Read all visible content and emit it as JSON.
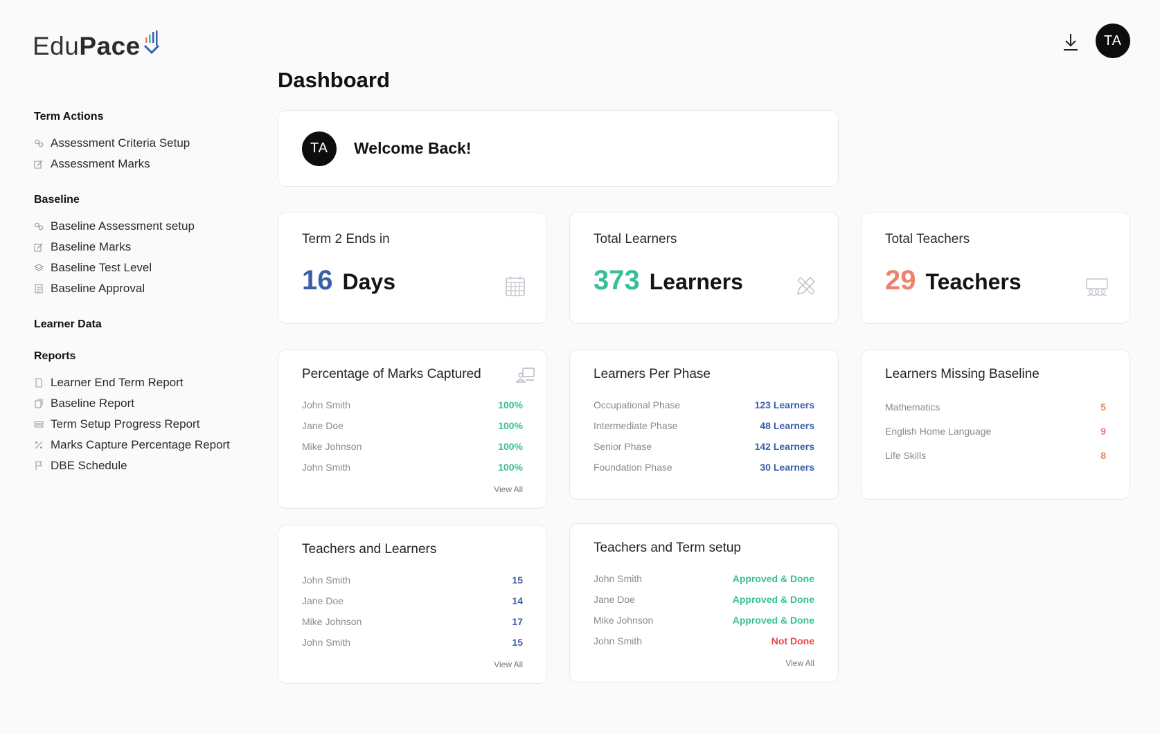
{
  "brand": {
    "name_part1": "Edu",
    "name_part2": "Pace"
  },
  "page_title": "Dashboard",
  "user": {
    "initials": "TA"
  },
  "sidebar": {
    "sections": [
      {
        "title": "Term Actions",
        "items": [
          {
            "label": "Assessment Criteria Setup",
            "icon": "gears-icon"
          },
          {
            "label": "Assessment Marks",
            "icon": "edit-icon"
          }
        ]
      },
      {
        "title": "Baseline",
        "items": [
          {
            "label": "Baseline Assessment setup",
            "icon": "gears-icon"
          },
          {
            "label": "Baseline Marks",
            "icon": "edit-icon"
          },
          {
            "label": "Baseline Test Level",
            "icon": "layers-icon"
          },
          {
            "label": "Baseline Approval",
            "icon": "document-icon"
          }
        ]
      },
      {
        "title": "Learner Data",
        "items": []
      },
      {
        "title": "Reports",
        "items": [
          {
            "label": "Learner End Term Report",
            "icon": "file-icon"
          },
          {
            "label": "Baseline Report",
            "icon": "copy-icon"
          },
          {
            "label": "Term Setup Progress Report",
            "icon": "list-icon"
          },
          {
            "label": "Marks Capture Percentage Report",
            "icon": "percent-icon"
          },
          {
            "label": "DBE Schedule",
            "icon": "flag-icon"
          }
        ]
      }
    ]
  },
  "welcome": {
    "message": "Welcome Back!"
  },
  "stats": {
    "term": {
      "label": "Term 2 Ends in",
      "value": "16",
      "unit": "Days",
      "icon": "calendar-icon",
      "color": "#3a5fa8"
    },
    "learners": {
      "label": "Total Learners",
      "value": "373",
      "unit": "Learners",
      "icon": "pencil-ruler-icon",
      "color": "#37bf98"
    },
    "teachers": {
      "label": "Total Teachers",
      "value": "29",
      "unit": "Teachers",
      "icon": "classroom-icon",
      "color": "#f0806b"
    }
  },
  "marks_captured": {
    "title": "Percentage of Marks Captured",
    "icon": "teacher-board-icon",
    "rows": [
      {
        "name": "John Smith",
        "value": "100%"
      },
      {
        "name": "Jane Doe",
        "value": "100%"
      },
      {
        "name": "Mike Johnson",
        "value": "100%"
      },
      {
        "name": "John Smith",
        "value": "100%"
      }
    ],
    "view_all": "View All"
  },
  "learners_per_phase": {
    "title": "Learners Per Phase",
    "rows": [
      {
        "name": "Occupational Phase",
        "value": "123 Learners"
      },
      {
        "name": "Intermediate Phase",
        "value": "48 Learners"
      },
      {
        "name": "Senior Phase",
        "value": "142 Learners"
      },
      {
        "name": "Foundation Phase",
        "value": "30 Learners"
      }
    ]
  },
  "missing_baseline": {
    "title": "Learners Missing Baseline",
    "rows": [
      {
        "name": "Mathematics",
        "value": "5"
      },
      {
        "name": "English Home Language",
        "value": "9"
      },
      {
        "name": "Life Skills",
        "value": "8"
      }
    ]
  },
  "teachers_learners": {
    "title": "Teachers and Learners",
    "rows": [
      {
        "name": "John Smith",
        "value": "15"
      },
      {
        "name": "Jane Doe",
        "value": "14"
      },
      {
        "name": "Mike Johnson",
        "value": "17"
      },
      {
        "name": "John Smith",
        "value": "15"
      }
    ],
    "view_all": "View All"
  },
  "teachers_term_setup": {
    "title": "Teachers and Term setup",
    "rows": [
      {
        "name": "John Smith",
        "value": "Approved & Done",
        "status": "done"
      },
      {
        "name": "Jane Doe",
        "value": "Approved & Done",
        "status": "done"
      },
      {
        "name": "Mike Johnson",
        "value": "Approved & Done",
        "status": "done"
      },
      {
        "name": "John Smith",
        "value": "Not Done",
        "status": "not-done"
      }
    ],
    "view_all": "View All"
  }
}
